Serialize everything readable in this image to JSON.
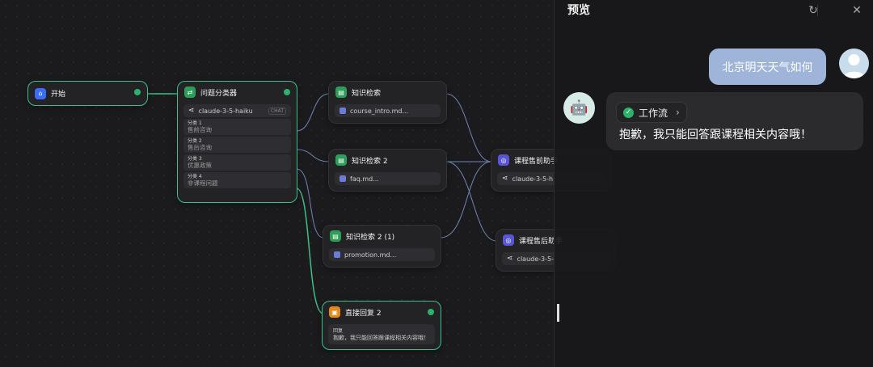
{
  "nodes": {
    "start": {
      "title": "开始"
    },
    "classifier": {
      "title": "问题分类器",
      "model": "claude-3-5-haiku",
      "model_badge": "CHAT",
      "classes": [
        {
          "tag": "分类 1",
          "value": "售前咨询"
        },
        {
          "tag": "分类 2",
          "value": "售后咨询"
        },
        {
          "tag": "分类 3",
          "value": "优惠政策"
        },
        {
          "tag": "分类 4",
          "value": "非课程问题"
        }
      ]
    },
    "kb1": {
      "title": "知识检索",
      "file": "course_intro.md..."
    },
    "kb2": {
      "title": "知识检索 2",
      "file": "faq.md..."
    },
    "kb3": {
      "title": "知识检索 2 (1)",
      "file": "promotion.md..."
    },
    "reply": {
      "title": "直接回复 2",
      "label": "回复",
      "text": "抱歉，我只能回答跟课程相关内容哦！"
    },
    "llm1": {
      "title": "课程售前助手",
      "model": "claude-3-5-h"
    },
    "llm2": {
      "title": "课程售后助手",
      "model": "claude-3-5-"
    }
  },
  "preview": {
    "title": "预览",
    "user_message": "北京明天天气如何",
    "workflow_label": "工作流",
    "bot_message": "抱歉，我只能回答跟课程相关内容哦！"
  },
  "colors": {
    "selected_border": "#3fbf8a",
    "edge_active": "#3fbf8a",
    "edge_inactive": "#6f86b8",
    "user_bubble": "#9fb4d9"
  }
}
